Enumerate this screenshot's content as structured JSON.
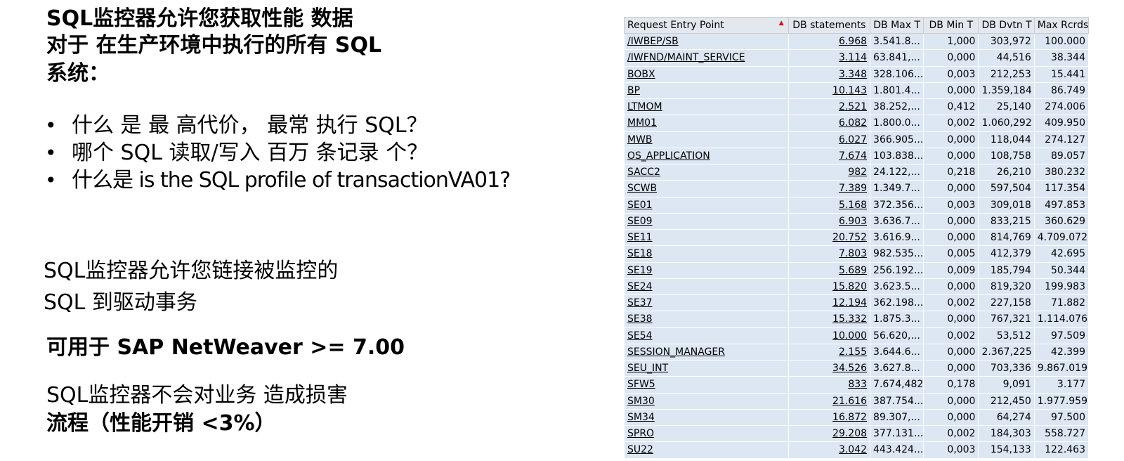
{
  "intro": {
    "l1_a": "SQL",
    "l1_b": "监控器允许您获取性能 数据",
    "l2_a": "对于 ",
    "l2_b": "在生产环境中执行的所有 SQL",
    "l3": "系统："
  },
  "bullets": [
    "什么 是 最 高代价，  最常 执行 SQL？",
    "哪个 SQL 读取/写入 百万 条记录 个？",
    "什么是 is the SQL profile of  transactionVA01?"
  ],
  "link_text": {
    "l1": "SQL监控器允许您链接被监控的",
    "l2": "SQL 到驱动事务"
  },
  "available": "可用于 SAP NetWeaver >= 7.00",
  "no_harm": {
    "l1": "SQL监控器不会对业务 造成损害",
    "l2": "流程（性能开销 <3%）"
  },
  "table": {
    "headers": [
      "Request Entry Point",
      "DB statements",
      "DB Max T",
      "DB Min T",
      "DB Dvtn T",
      "Max Rcrds"
    ],
    "rows": [
      [
        "/IWBEP/SB",
        "6.968",
        "3.541.8...",
        "1,000",
        "303,972",
        "100.000"
      ],
      [
        "/IWFND/MAINT_SERVICE",
        "3.114",
        "63.841,...",
        "0,000",
        "44,516",
        "38.344"
      ],
      [
        "BOBX",
        "3.348",
        "328.106...",
        "0,003",
        "212,253",
        "15.441"
      ],
      [
        "BP",
        "10.143",
        "1.801.4...",
        "0,000",
        "1.359,184",
        "86.749"
      ],
      [
        "LTMOM",
        "2.521",
        "38.252,...",
        "0,412",
        "25,140",
        "274.006"
      ],
      [
        "MM01",
        "6.082",
        "1.800.0...",
        "0,002",
        "1.060,292",
        "409.950"
      ],
      [
        "MWB",
        "6.027",
        "366.905...",
        "0,000",
        "118,044",
        "274.127"
      ],
      [
        "OS_APPLICATION",
        "7.674",
        "103.838...",
        "0,000",
        "108,758",
        "89.057"
      ],
      [
        "SACC2",
        "982",
        "24.122,...",
        "0,218",
        "26,210",
        "380.232"
      ],
      [
        "SCWB",
        "7.389",
        "1.349.7...",
        "0,000",
        "597,504",
        "117.354"
      ],
      [
        "SE01",
        "5.168",
        "372.356...",
        "0,003",
        "309,018",
        "497.853"
      ],
      [
        "SE09",
        "6.903",
        "3.636.7...",
        "0,000",
        "833,215",
        "360.629"
      ],
      [
        "SE11",
        "20.752",
        "3.616.9...",
        "0,000",
        "814,769",
        "4.709.072"
      ],
      [
        "SE18",
        "7.803",
        "982.535...",
        "0,005",
        "412,379",
        "42.695"
      ],
      [
        "SE19",
        "5.689",
        "256.192...",
        "0,009",
        "185,794",
        "50.344"
      ],
      [
        "SE24",
        "15.820",
        "3.623.5...",
        "0,000",
        "819,320",
        "199.983"
      ],
      [
        "SE37",
        "12.194",
        "362.198...",
        "0,002",
        "227,158",
        "71.882"
      ],
      [
        "SE38",
        "15.332",
        "1.875.3...",
        "0,000",
        "767,321",
        "1.114.076"
      ],
      [
        "SE54",
        "10.000",
        "56.620,...",
        "0,002",
        "53,512",
        "97.509"
      ],
      [
        "SESSION_MANAGER",
        "2.155",
        "3.644.6...",
        "0,000",
        "2.367,225",
        "42.399"
      ],
      [
        "SEU_INT",
        "34.526",
        "3.627.8...",
        "0,000",
        "703,336",
        "9.867.019"
      ],
      [
        "SFW5",
        "833",
        "7.674,482",
        "0,178",
        "9,091",
        "3.177"
      ],
      [
        "SM30",
        "21.616",
        "387.754...",
        "0,000",
        "212,450",
        "1.977.959"
      ],
      [
        "SM34",
        "16.872",
        "89.307,...",
        "0,000",
        "64,274",
        "97.500"
      ],
      [
        "SPRO",
        "29.208",
        "377.131...",
        "0,002",
        "184,303",
        "558.727"
      ],
      [
        "SU22",
        "3.042",
        "443.424...",
        "0,003",
        "154,133",
        "122.463"
      ]
    ]
  },
  "colors": {
    "row_bg": "#dde7f3",
    "header_bg": "#e3e8ef",
    "sort_indicator": "#d01010"
  }
}
